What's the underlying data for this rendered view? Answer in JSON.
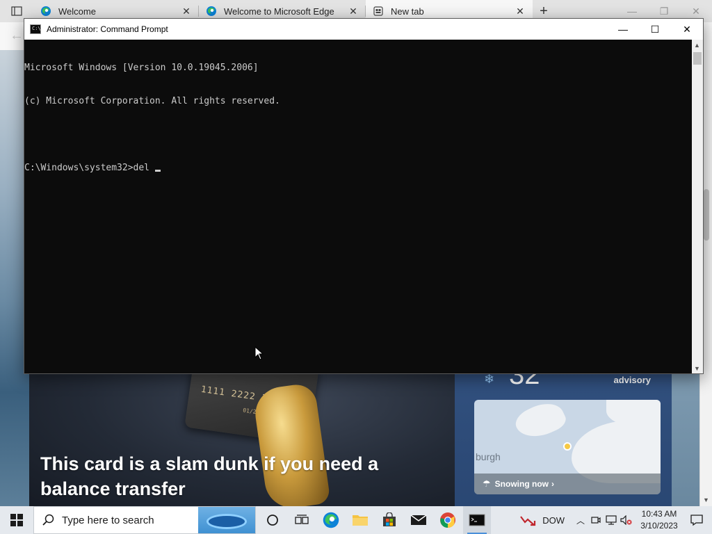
{
  "browser": {
    "tabs": [
      {
        "label": "Welcome",
        "icon": "edge-icon",
        "active": false
      },
      {
        "label": "Welcome to Microsoft Edge",
        "icon": "edge-icon",
        "active": false
      },
      {
        "label": "New tab",
        "icon": "newtab-page-icon",
        "active": true
      }
    ],
    "close_glyph": "✕",
    "new_tab_glyph": "+",
    "window_controls": {
      "minimize": "—",
      "restore": "❐",
      "close": "✕"
    }
  },
  "ntp": {
    "news_headline": "This card is a slam dunk if you need a balance transfer",
    "card_number": "1111 2222 3333 444",
    "card_expiry": "01/27",
    "weather": {
      "temperature": "32",
      "advisory": "advisory",
      "city": "burgh",
      "status": "Snowing now",
      "status_chevron": "›"
    }
  },
  "cmd": {
    "title": "Administrator: Command Prompt",
    "lines": [
      "Microsoft Windows [Version 10.0.19045.2006]",
      "(c) Microsoft Corporation. All rights reserved.",
      "",
      "C:\\Windows\\system32>del "
    ],
    "window_controls": {
      "minimize": "—",
      "maximize": "☐",
      "close": "✕"
    },
    "icon_text": "C:\\"
  },
  "taskbar": {
    "search_placeholder": "Type here to search",
    "pinned": [
      "cortana-icon",
      "task-view-icon",
      "edge-icon",
      "file-explorer-icon",
      "store-icon",
      "mail-icon",
      "chrome-icon",
      "command-prompt-icon"
    ],
    "stock_label": "DOW",
    "time": "10:43 AM",
    "date": "3/10/2023"
  },
  "colors": {
    "cmd_bg": "#0c0c0c",
    "cmd_text": "#cccccc",
    "taskbar_bg": "#e5e9ee",
    "accent": "#0078d4"
  }
}
